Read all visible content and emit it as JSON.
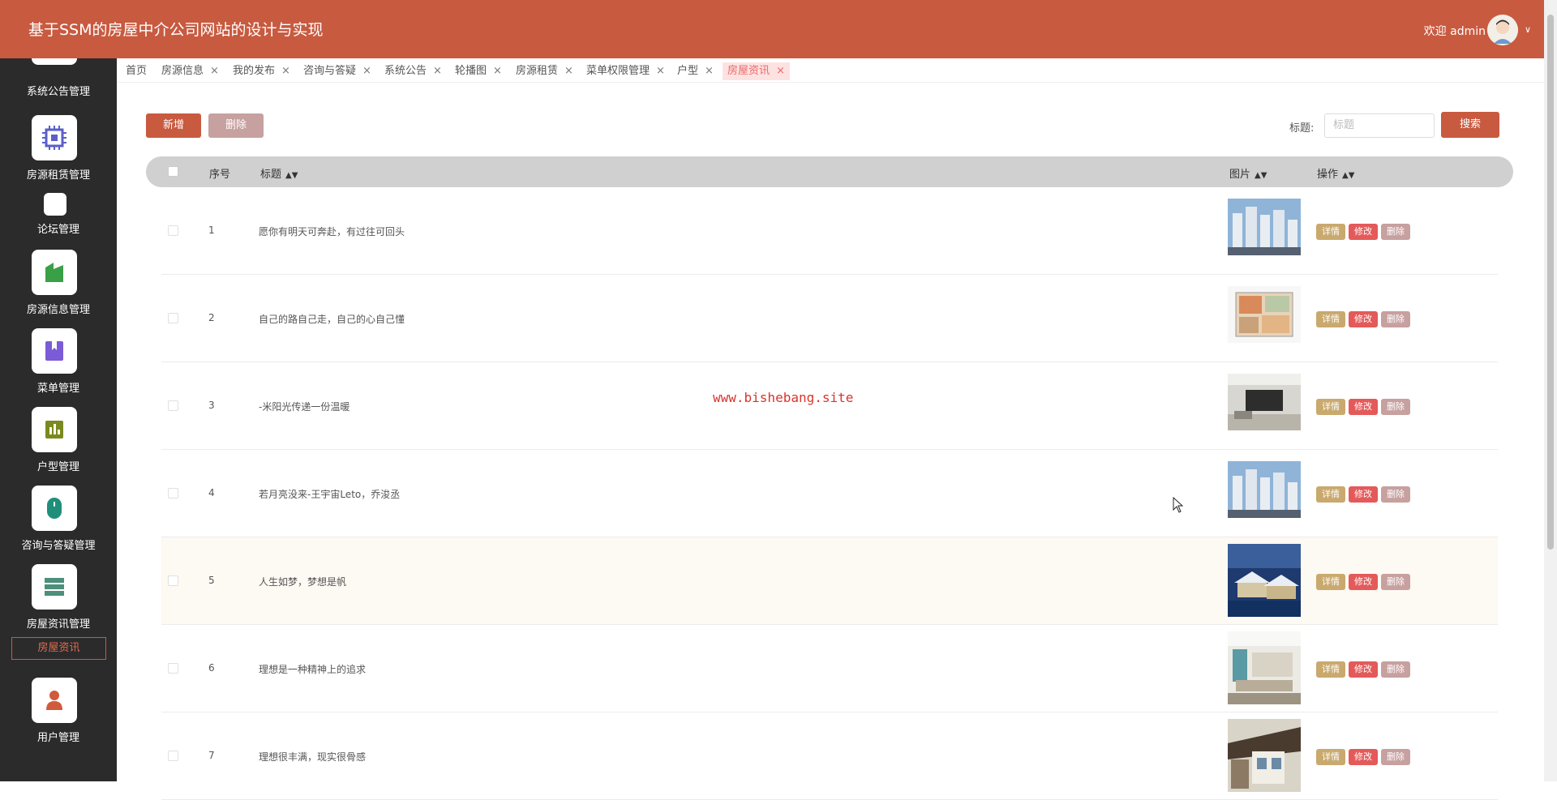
{
  "header": {
    "title": "基于SSM的房屋中介公司网站的设计与实现",
    "welcome": "欢迎 admin"
  },
  "sidebar": {
    "items": [
      {
        "label": "系统公告管理",
        "icon": "notice-icon"
      },
      {
        "label": "房源租赁管理",
        "icon": "chip-icon"
      },
      {
        "label": "论坛管理",
        "icon": "forum-icon"
      },
      {
        "label": "房源信息管理",
        "icon": "building-icon"
      },
      {
        "label": "菜单管理",
        "icon": "bookmark-icon"
      },
      {
        "label": "户型管理",
        "icon": "chart-icon"
      },
      {
        "label": "咨询与答疑管理",
        "icon": "mouse-icon"
      },
      {
        "label": "房屋资讯管理",
        "icon": "list-icon"
      },
      {
        "label": "用户管理",
        "icon": "user-icon"
      }
    ],
    "active_sub": "房屋资讯"
  },
  "tabs": [
    {
      "label": "首页",
      "closable": false
    },
    {
      "label": "房源信息",
      "closable": true
    },
    {
      "label": "我的发布",
      "closable": true
    },
    {
      "label": "咨询与答疑",
      "closable": true
    },
    {
      "label": "系统公告",
      "closable": true
    },
    {
      "label": "轮播图",
      "closable": true
    },
    {
      "label": "房源租赁",
      "closable": true
    },
    {
      "label": "菜单权限管理",
      "closable": true
    },
    {
      "label": "户型",
      "closable": true
    },
    {
      "label": "房屋资讯",
      "closable": true,
      "active": true
    }
  ],
  "toolbar": {
    "add_label": "新增",
    "delete_label": "删除",
    "search_label": "标题:",
    "search_placeholder": "标题",
    "search_button": "搜索"
  },
  "table": {
    "columns": [
      "序号",
      "标题",
      "图片",
      "操作"
    ],
    "action_labels": {
      "detail": "详情",
      "edit": "修改",
      "delete": "删除"
    },
    "rows": [
      {
        "index": "1",
        "title": "愿你有明天可奔赴，有过往可回头",
        "image": "high-rise-buildings"
      },
      {
        "index": "2",
        "title": "自己的路自己走，自己的心自己懂",
        "image": "floor-plan"
      },
      {
        "index": "3",
        "title": "-米阳光传递一份温暖",
        "image": "living-room"
      },
      {
        "index": "4",
        "title": "若月亮没来-王宇宙Leto，乔浚丞",
        "image": "high-rise-buildings"
      },
      {
        "index": "5",
        "title": "人生如梦，梦想是帆",
        "image": "villa-dusk"
      },
      {
        "index": "6",
        "title": "理想是一种精神上的追求",
        "image": "sitting-room"
      },
      {
        "index": "7",
        "title": "理想很丰满，现实很骨感",
        "image": "modern-house"
      }
    ]
  },
  "watermark": "www.bishebang.site",
  "colors": {
    "header": "#c85a40",
    "sidebar": "#2b2b2b",
    "detail": "#c9a96e",
    "edit": "#e45a5a",
    "delete": "#c7a0a0"
  }
}
